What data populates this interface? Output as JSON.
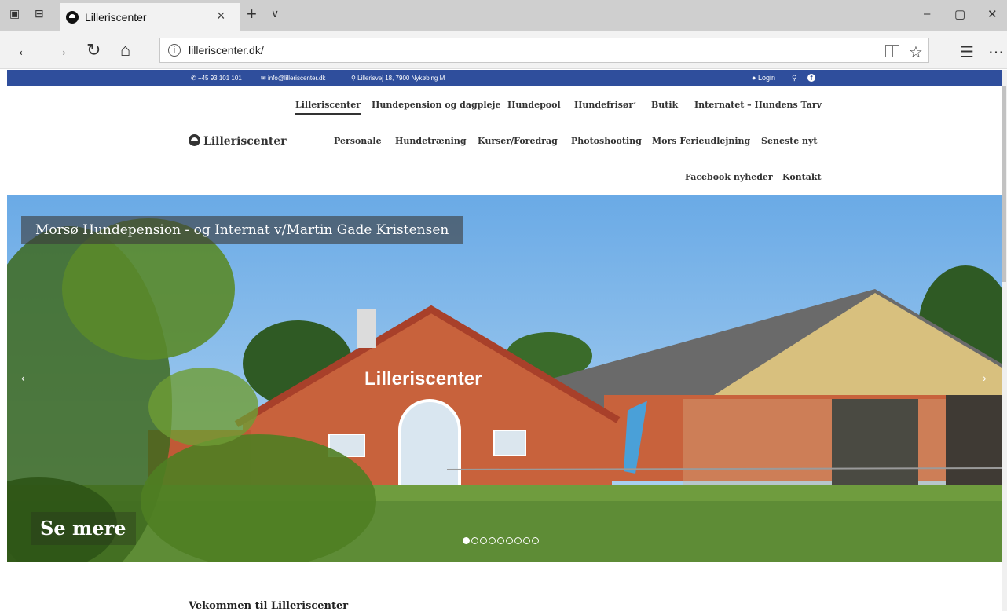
{
  "browser": {
    "tab_title": "Lilleriscenter",
    "url": "lilleriscenter.dk/"
  },
  "topbar": {
    "phone": "+45 93 101 101",
    "email": "info@lilleriscenter.dk",
    "address": "Lillerisvej 18, 7900 Nykøbing M",
    "login": "Login"
  },
  "site": {
    "logo_text": "Lilleriscenter"
  },
  "nav": {
    "items": [
      "Lilleriscenter",
      "Hundepension og dagpleje",
      "Hundepool",
      "Hundefrisør",
      "Butik",
      "Internatet – Hundens Tarv",
      "Personale",
      "Hundetræning",
      "Kurser/Foredrag",
      "Photoshooting",
      "Mors Ferieudlejning",
      "Seneste nyt",
      "Facebook nyheder",
      "Kontakt"
    ],
    "active_index": 0
  },
  "hero": {
    "caption": "Morsø Hundepension - og Internat v/Martin Gade Kristensen",
    "building_sign": "Lilleriscenter",
    "cta": "Se mere",
    "slide_count": 9,
    "active_slide": 1
  },
  "content": {
    "welcome_heading": "Vekommen til Lilleriscenter"
  },
  "colors": {
    "topbar_bg": "#2f4e9c",
    "brick": "#c8623c",
    "roof_red": "#a8402a",
    "grass": "#5e8c36",
    "sky": "#7bb6ea"
  },
  "icons": [
    "back-arrow-icon",
    "forward-arrow-icon",
    "refresh-icon",
    "home-icon",
    "info-icon",
    "reading-view-icon",
    "favorite-star-icon",
    "favorites-hub-icon",
    "more-icon",
    "phone-icon",
    "mail-icon",
    "map-pin-icon",
    "user-icon",
    "search-icon",
    "facebook-icon",
    "chevron-left-icon",
    "chevron-right-icon"
  ]
}
